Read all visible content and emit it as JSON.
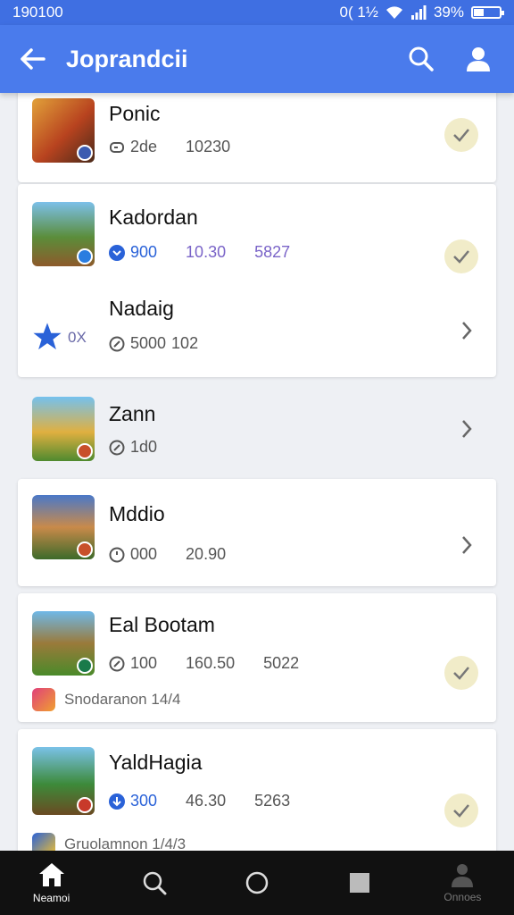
{
  "status": {
    "time": "190100",
    "right_text": "0( 1½",
    "battery": "39%",
    "battery_level": 0.39
  },
  "appbar": {
    "title": "Joprandcii",
    "icons": [
      "back-arrow-icon",
      "search-icon",
      "account-icon"
    ]
  },
  "items": [
    {
      "name": "Ponic",
      "meta": [
        "2de",
        "10230"
      ],
      "action": "check"
    },
    {
      "name": "Kadordan",
      "meta": [
        "900",
        "10.30",
        "5827"
      ],
      "action": "check"
    },
    {
      "name": "Nadaig",
      "prefix": "0X",
      "meta": [
        "5000",
        "102"
      ],
      "action": "chevron"
    },
    {
      "name": "Zann",
      "meta": [
        "1d0"
      ],
      "action": "chevron"
    },
    {
      "name": "Mddio",
      "meta": [
        "000",
        "20.90"
      ],
      "action": "chevron"
    },
    {
      "name": "Eal Bootam",
      "meta": [
        "100",
        "160.50",
        "5022"
      ],
      "sub": "Snodaranon 14/4",
      "action": "check"
    },
    {
      "name": "YaldHagia",
      "meta": [
        "300",
        "46.30",
        "5263"
      ],
      "sub": "Gruolamnon 1/4/3",
      "action": "check"
    }
  ],
  "nav": [
    {
      "label": "Neamoi",
      "icon": "home-icon",
      "active": true
    },
    {
      "label": "",
      "icon": "search-icon"
    },
    {
      "label": "",
      "icon": "circle-icon"
    },
    {
      "label": "",
      "icon": "square-icon"
    },
    {
      "label": "Onnoes",
      "icon": "person-icon"
    }
  ],
  "colors": {
    "appbar": "#4a7bec",
    "statusbar": "#3f6fe2",
    "check_bg": "#f1ecc9",
    "navbar": "#111111"
  }
}
